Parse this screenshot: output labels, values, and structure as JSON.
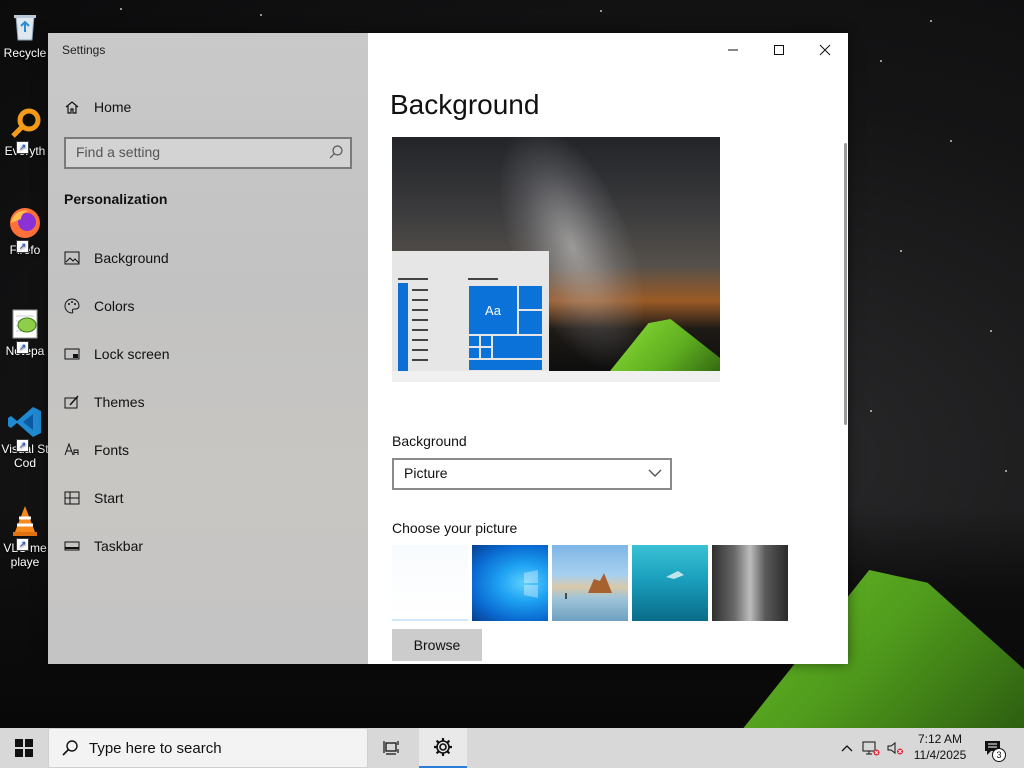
{
  "desktop": {
    "icons": [
      {
        "label": "Recycle"
      },
      {
        "label": "Everyth"
      },
      {
        "label": "Firefo"
      },
      {
        "label": "Notepa"
      },
      {
        "label_line1": "Visual St",
        "label_line2": "Cod"
      },
      {
        "label_line1": "VLC me",
        "label_line2": "playe"
      }
    ]
  },
  "window": {
    "title": "Settings",
    "controls": {
      "minimize": "minimize-icon",
      "maximize": "maximize-icon",
      "close": "close-icon"
    }
  },
  "sidebar": {
    "home_label": "Home",
    "search_placeholder": "Find a setting",
    "section_title": "Personalization",
    "items": [
      {
        "label": "Background",
        "icon": "picture-icon"
      },
      {
        "label": "Colors",
        "icon": "palette-icon"
      },
      {
        "label": "Lock screen",
        "icon": "lock-screen-icon"
      },
      {
        "label": "Themes",
        "icon": "brush-icon"
      },
      {
        "label": "Fonts",
        "icon": "font-icon"
      },
      {
        "label": "Start",
        "icon": "start-icon"
      },
      {
        "label": "Taskbar",
        "icon": "taskbar-icon"
      }
    ]
  },
  "main": {
    "page_title": "Background",
    "preview_tile_label": "Aa",
    "background_label": "Background",
    "background_value": "Picture",
    "choose_label": "Choose your picture",
    "browse_label": "Browse"
  },
  "taskbar": {
    "search_placeholder": "Type here to search",
    "time": "7:12 AM",
    "date": "11/4/2025",
    "notification_count": "3",
    "accent_color": "#2a7fd6"
  }
}
